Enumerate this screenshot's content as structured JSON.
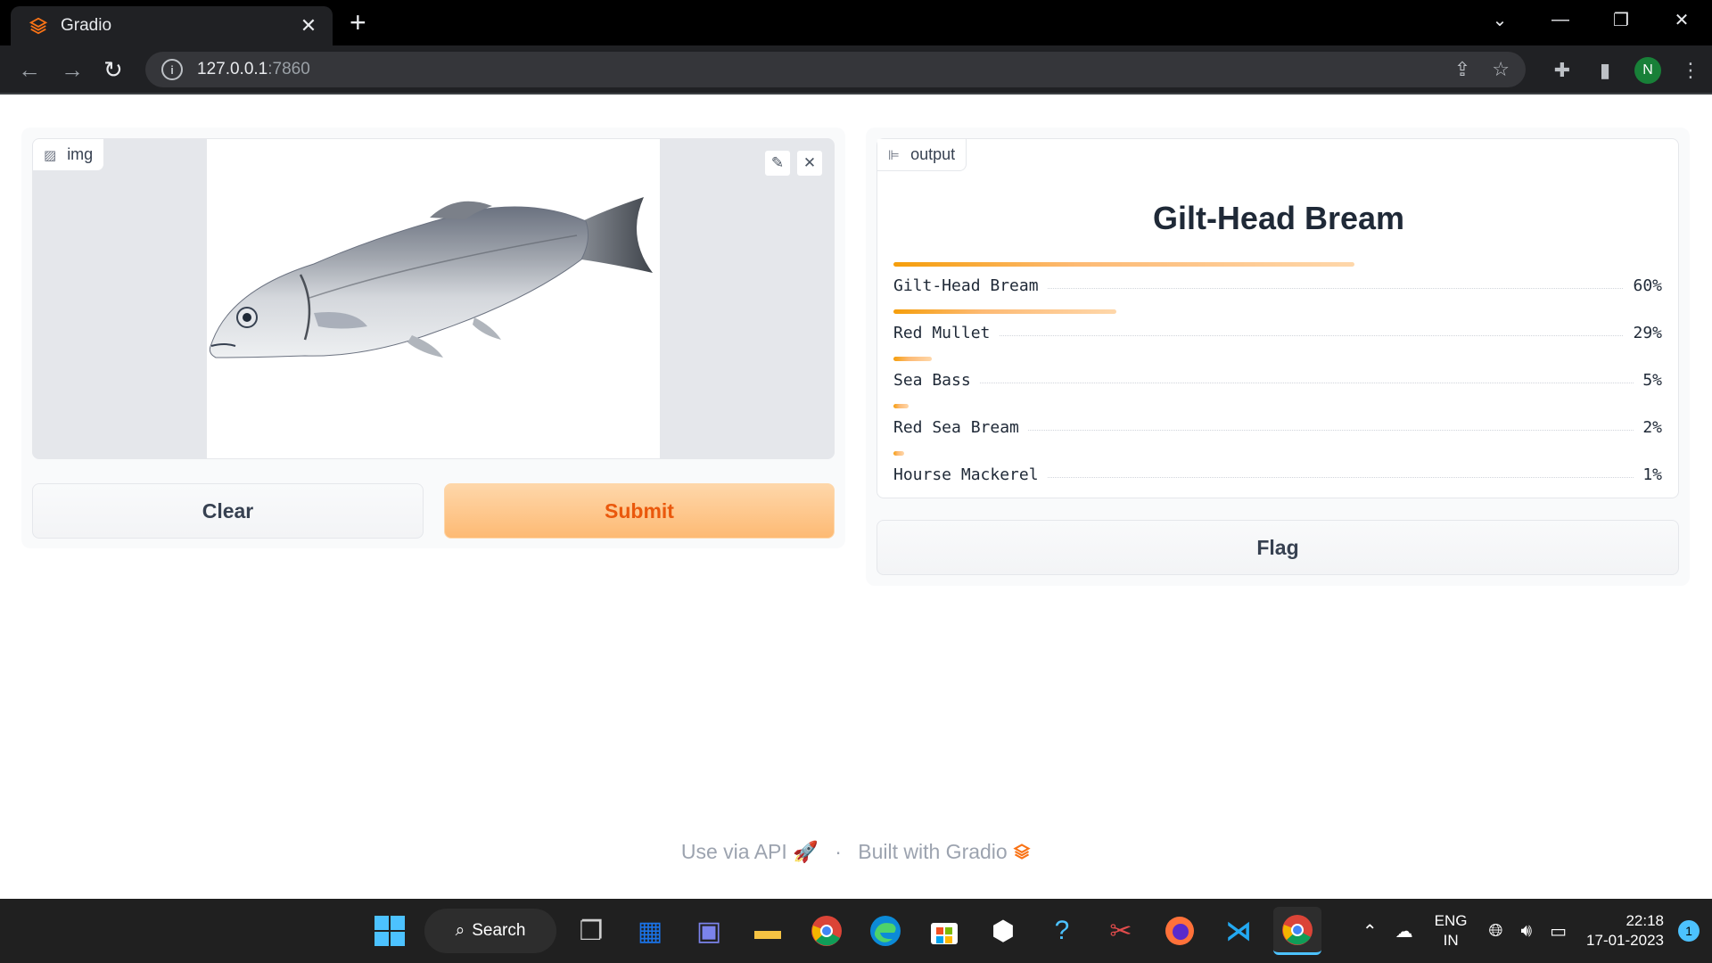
{
  "browser": {
    "tab_title": "Gradio",
    "tab_close": "✕",
    "new_tab": "+",
    "url_host": "127.0.0.1",
    "url_port": ":7860",
    "profile_initial": "N"
  },
  "input_panel": {
    "label": "img",
    "clear_label": "Clear",
    "submit_label": "Submit"
  },
  "output_panel": {
    "label": "output",
    "title": "Gilt-Head Bream",
    "confidences": [
      {
        "label": "Gilt-Head Bream",
        "value": 0.6,
        "pct": "60%"
      },
      {
        "label": "Red Mullet",
        "value": 0.29,
        "pct": "29%"
      },
      {
        "label": "Sea Bass",
        "value": 0.05,
        "pct": "5%"
      },
      {
        "label": "Red Sea Bream",
        "value": 0.02,
        "pct": "2%"
      },
      {
        "label": "Hourse Mackerel",
        "value": 0.01,
        "pct": "1%"
      }
    ],
    "flag_label": "Flag"
  },
  "footer": {
    "api_text": "Use via API",
    "sep": "·",
    "built_text": "Built with Gradio"
  },
  "taskbar": {
    "search_label": "Search",
    "lang_1": "ENG",
    "lang_2": "IN",
    "time": "22:18",
    "date": "17-01-2023",
    "notifications": "1"
  },
  "colors": {
    "accent": "#f97316",
    "submit_bg": "#fdba74",
    "submit_text": "#ea580c"
  }
}
